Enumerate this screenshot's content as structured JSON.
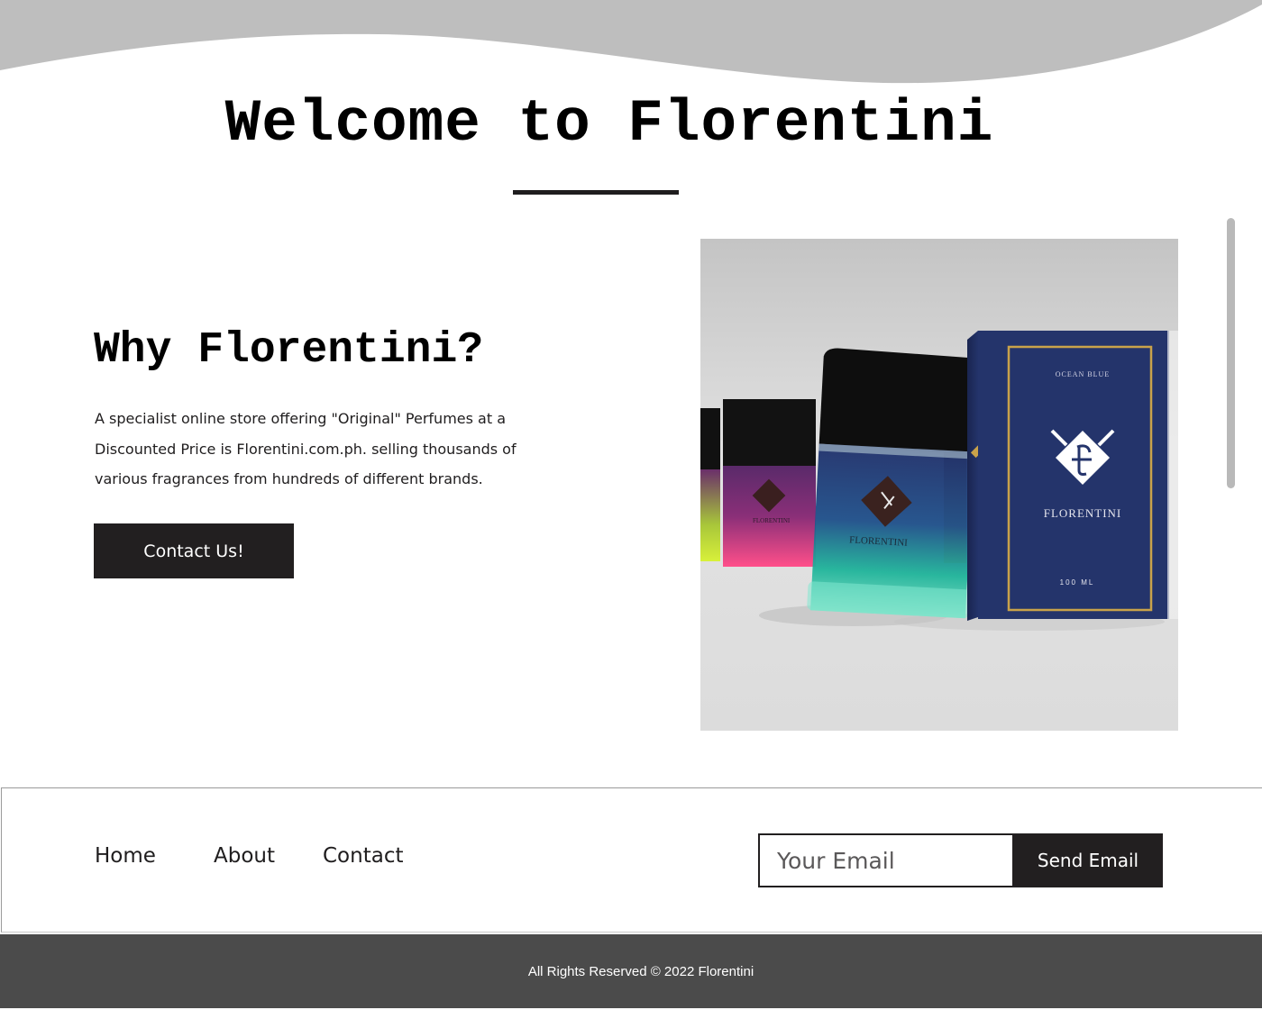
{
  "header": {
    "title": "Welcome to Florentini"
  },
  "why": {
    "title": "Why Florentini?",
    "description": "A specialist online store offering \"Original\" Perfumes at a Discounted Price is Florentini.com.ph. selling thousands of various fragrances from hundreds of different brands.",
    "cta_label": "Contact Us!"
  },
  "product_image": {
    "box_top_text": "OCEAN BLUE",
    "box_brand": "FLORENTINI",
    "box_volume": "100 ML",
    "bottle_label": "FLORENTINI"
  },
  "footer_nav": {
    "links": [
      {
        "label": "Home"
      },
      {
        "label": "About"
      },
      {
        "label": "Contact"
      }
    ],
    "email_placeholder": "Your Email",
    "send_label": "Send Email"
  },
  "copyright": {
    "text": "All Rights Reserved © 2022 Florentini"
  },
  "colors": {
    "dark": "#221f20",
    "wave": "#bebebe",
    "footer_bar": "#4b4b4b",
    "box_navy": "#24346b",
    "box_gold": "#c9a24a"
  }
}
